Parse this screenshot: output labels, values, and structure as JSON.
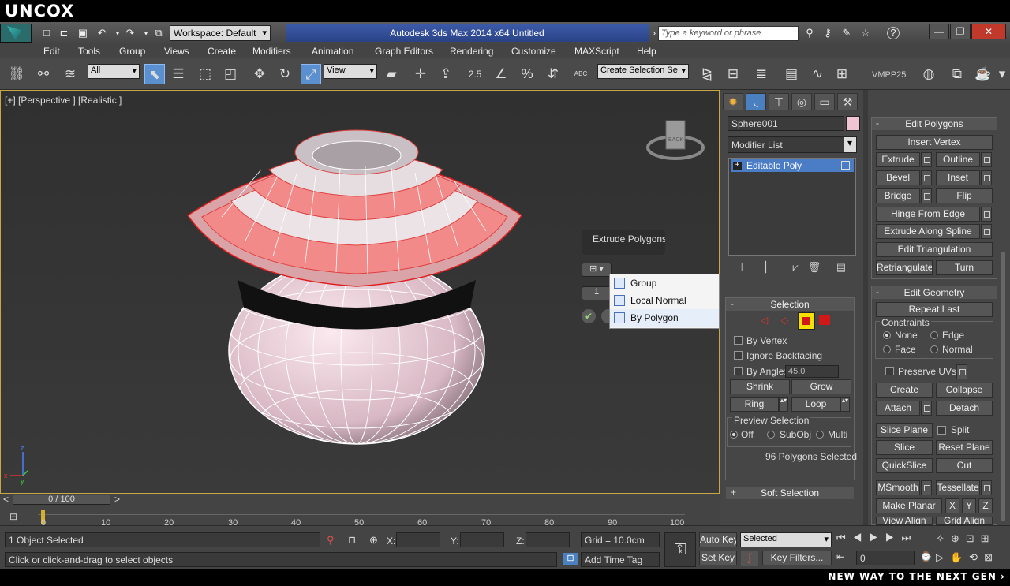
{
  "brand": {
    "logo": "UNCOX",
    "tagline": "NEW WAY TO THE NEXT GEN ›"
  },
  "titlebar": {
    "workspace": "Workspace: Default",
    "title": "Autodesk 3ds Max  2014 x64     Untitled",
    "search_placeholder": "Type a keyword or phrase",
    "help": "?",
    "minimize": "—",
    "restore": "❐",
    "close": "✕"
  },
  "menu": [
    "Edit",
    "Tools",
    "Group",
    "Views",
    "Create",
    "Modifiers",
    "Animation",
    "Graph Editors",
    "Rendering",
    "Customize",
    "MAXScript",
    "Help"
  ],
  "toolbar": {
    "filter": "All",
    "ref_coord": "View",
    "snap_angle": "2.5",
    "named_selection": "Create Selection Se",
    "vmpp": "VMPP25",
    "abc": "ABC"
  },
  "viewport": {
    "label": "[+] [Perspective ] [Realistic ]",
    "viewcube": "BACK",
    "axis_z": "z",
    "axis_x": "x",
    "axis_y": "y",
    "caddy_title": "Extrude Polygons",
    "caddy_value": "1",
    "popup_items": [
      "Group",
      "Local Normal",
      "By Polygon"
    ],
    "colors": {
      "selected": "#f28a8a",
      "mesh": "#ffffff",
      "sphere": "#f0d0dc",
      "bg": "#363636",
      "arrow": "#d01818"
    }
  },
  "command_panel": {
    "object_name": "Sphere001",
    "object_color": "#f0c4d3",
    "modifier_list": "Modifier List",
    "stack_item": "Editable Poly",
    "stack_expand": "+",
    "selection": {
      "title": "Selection",
      "by_vertex": "By Vertex",
      "ignore_backfacing": "Ignore Backfacing",
      "by_angle": "By Angle:",
      "angle_value": "45.0",
      "shrink": "Shrink",
      "grow": "Grow",
      "ring": "Ring",
      "loop": "Loop",
      "preview_title": "Preview Selection",
      "preview_off": "Off",
      "preview_subobj": "SubObj",
      "preview_multi": "Multi",
      "count": "96 Polygons Selected"
    },
    "soft_selection": "Soft Selection",
    "edit_polygons": {
      "title": "Edit Polygons",
      "insert_vertex": "Insert Vertex",
      "extrude": "Extrude",
      "outline": "Outline",
      "bevel": "Bevel",
      "inset": "Inset",
      "bridge": "Bridge",
      "flip": "Flip",
      "hinge": "Hinge From Edge",
      "extrude_spline": "Extrude Along Spline",
      "edit_tri": "Edit Triangulation",
      "retriangulate": "Retriangulate",
      "turn": "Turn"
    },
    "edit_geometry": {
      "title": "Edit Geometry",
      "repeat_last": "Repeat Last",
      "constraints": "Constraints",
      "none": "None",
      "edge": "Edge",
      "face": "Face",
      "normal": "Normal",
      "preserve_uvs": "Preserve UVs",
      "create": "Create",
      "collapse": "Collapse",
      "attach": "Attach",
      "detach": "Detach",
      "slice_plane": "Slice Plane",
      "split": "Split",
      "slice": "Slice",
      "reset_plane": "Reset Plane",
      "quickslice": "QuickSlice",
      "cut": "Cut",
      "msmooth": "MSmooth",
      "tessellate": "Tessellate",
      "make_planar": "Make Planar",
      "x": "X",
      "y": "Y",
      "z": "Z",
      "view_align": "View Align",
      "grid_align": "Grid Align"
    },
    "rollout_minus": "-",
    "rollout_plus": "+"
  },
  "timeline": {
    "slider": "0 / 100",
    "prev": "<",
    "next": ">",
    "ticks": [
      "0",
      "10",
      "20",
      "30",
      "40",
      "50",
      "60",
      "70",
      "80",
      "90",
      "100"
    ]
  },
  "status": {
    "objects": "1 Object Selected",
    "prompt": "Click or click-and-drag to select objects",
    "x_label": "X:",
    "y_label": "Y:",
    "z_label": "Z:",
    "grid": "Grid = 10.0cm",
    "add_time_tag": "Add Time Tag",
    "auto_key": "Auto Key",
    "set_key": "Set Key",
    "key_mode": "Selected",
    "key_filters": "Key Filters...",
    "frame": "0"
  }
}
